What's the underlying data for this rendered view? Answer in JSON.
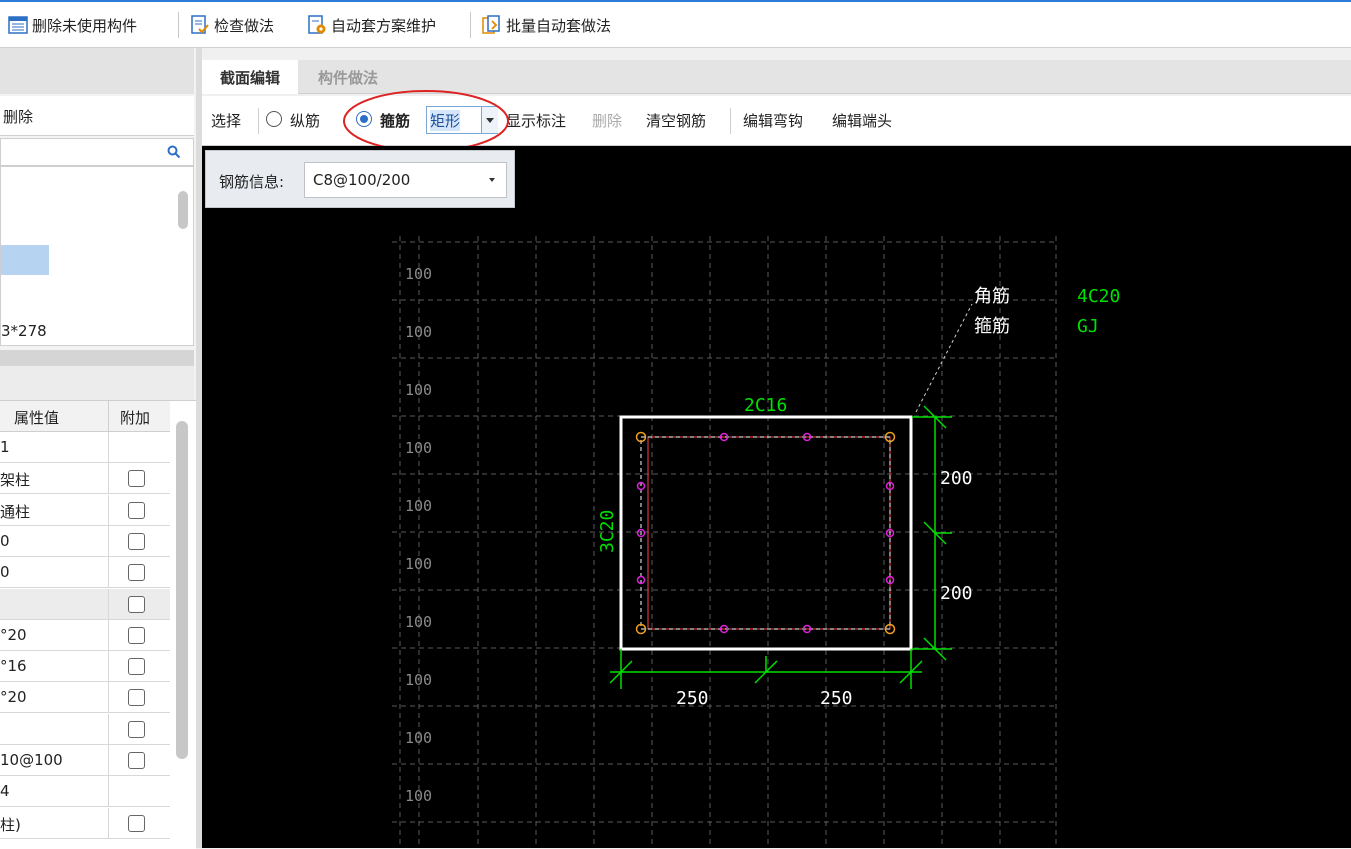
{
  "toolbar": {
    "items": [
      {
        "label": "删除未使用构件",
        "icon": "list-delete-icon"
      },
      {
        "label": "检查做法",
        "icon": "check-doc-icon"
      },
      {
        "label": "自动套方案维护",
        "icon": "auto-scheme-icon"
      },
      {
        "label": "批量自动套做法",
        "icon": "batch-auto-icon"
      }
    ]
  },
  "left_panel": {
    "delete_label": "删除",
    "selected_suffix": "3*278",
    "prop_table": {
      "col_value": "属性值",
      "col_extra": "附加",
      "rows": [
        {
          "value": "1",
          "checkbox": false
        },
        {
          "value": "架柱",
          "checkbox": true
        },
        {
          "value": "通柱",
          "checkbox": true
        },
        {
          "value": "0",
          "checkbox": true
        },
        {
          "value": "0",
          "checkbox": true
        },
        {
          "value": "",
          "checkbox": true,
          "shaded": true
        },
        {
          "value": "°20",
          "checkbox": true
        },
        {
          "value": "°16",
          "checkbox": true
        },
        {
          "value": "°20",
          "checkbox": true
        },
        {
          "value": "",
          "checkbox": true
        },
        {
          "value": "10@100",
          "checkbox": true
        },
        {
          "value": "4",
          "checkbox": false
        },
        {
          "value": "柱)",
          "checkbox": true
        }
      ]
    }
  },
  "tabs": {
    "section_edit": "截面编辑",
    "component_method": "构件做法"
  },
  "edit_toolbar": {
    "select": "选择",
    "longitudinal": "纵筋",
    "stirrup": "箍筋",
    "shape_value": "矩形",
    "show_marks": "显示标注",
    "delete": "删除",
    "clear_rebar": "清空钢筋",
    "edit_hook": "编辑弯钩",
    "edit_end": "编辑端头"
  },
  "rebar_info": {
    "label": "钢筋信息:",
    "value": "C8@100/200"
  },
  "drawing": {
    "grid_labels": [
      "100",
      "100",
      "100",
      "100",
      "100",
      "100",
      "100",
      "100",
      "100",
      "100"
    ],
    "legend": {
      "corner_label": "角筋",
      "corner_value": "4C20",
      "stirrup_label": "箍筋",
      "stirrup_value": "GJ"
    },
    "top_rebar": "2C16",
    "side_rebar": "3C20",
    "dim_right_1": "200",
    "dim_right_2": "200",
    "dim_bottom_1": "250",
    "dim_bottom_2": "250"
  },
  "colors": {
    "accent": "#2d7bd8",
    "canvas_bg": "#000000",
    "dim_green": "#00e000",
    "stirrup_red": "#ff4040",
    "rebar_magenta": "#e020e0",
    "corner_orange": "#f0a020"
  }
}
